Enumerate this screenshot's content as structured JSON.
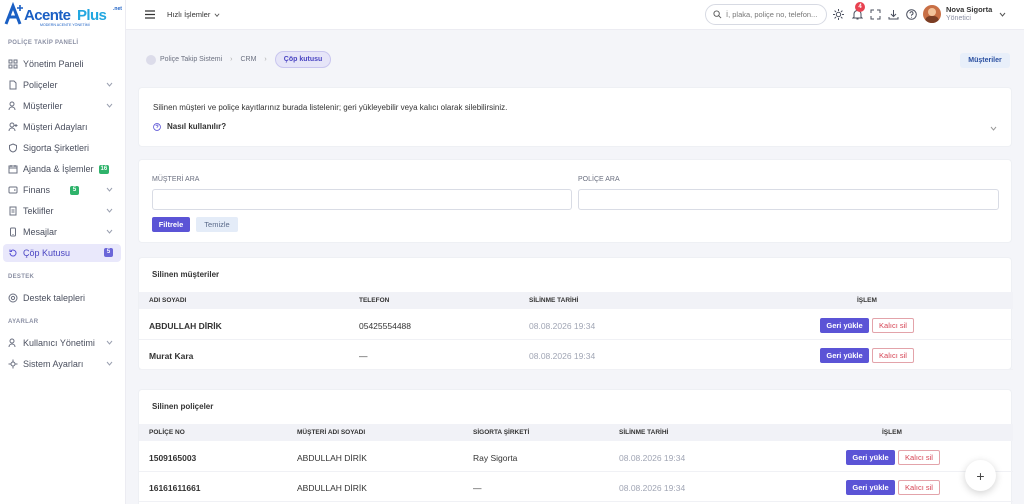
{
  "logo": {
    "name": "AcentePlus",
    "net": ".net",
    "tagline": "MODERN ACENTE YÖNETİMİ"
  },
  "sidebar": {
    "section1": "POLİÇE TAKİP PANELİ",
    "items": [
      {
        "label": "Yönetim Paneli",
        "icon": "grid-icon"
      },
      {
        "label": "Poliçeler",
        "icon": "document-icon",
        "chevron": true
      },
      {
        "label": "Müşteriler",
        "icon": "users-icon",
        "chevron": true
      },
      {
        "label": "Müşteri Adayları",
        "icon": "user-plus-icon"
      },
      {
        "label": "Sigorta Şirketleri",
        "icon": "shield-icon"
      },
      {
        "label": "Ajanda & İşlemler",
        "icon": "calendar-icon",
        "badge": "16",
        "badge_color": "#2fb36b"
      },
      {
        "label": "Finans",
        "icon": "wallet-icon",
        "badge": "5",
        "badge_color": "#2fb36b",
        "chevron": true
      },
      {
        "label": "Teklifler",
        "icon": "file-icon",
        "chevron": true
      },
      {
        "label": "Mesajlar",
        "icon": "phone-icon",
        "chevron": true
      },
      {
        "label": "Çöp Kutusu",
        "icon": "recycle-icon",
        "badge": "5",
        "badge_color": "#6b66d9",
        "active": true
      }
    ],
    "section2": "DESTEK",
    "support": {
      "label": "Destek talepleri",
      "icon": "support-icon"
    },
    "section3": "AYARLAR",
    "settings": [
      {
        "label": "Kullanıcı Yönetimi",
        "icon": "user-settings-icon",
        "chevron": true
      },
      {
        "label": "Sistem Ayarları",
        "icon": "gear-icon",
        "chevron": true
      }
    ]
  },
  "topbar": {
    "quick_actions": "Hızlı İşlemler",
    "search_placeholder": "İ, plaka, poliçe no, telefon...",
    "notif_count": "4",
    "user_name": "Nova Sigorta",
    "user_role": "Yönetici"
  },
  "breadcrumb": {
    "items": [
      "Poliçe Takip Sistemi",
      "CRM",
      "Çöp kutusu"
    ],
    "right_button": "Müşteriler"
  },
  "info": {
    "text": "Silinen müşteri ve poliçe kayıtlarınız burada listelenir; geri yükleyebilir veya kalıcı olarak silebilirsiniz.",
    "howto": "Nasıl kullanılır?"
  },
  "filter": {
    "customer_label": "MÜŞTERİ ARA",
    "policy_label": "POLİÇE ARA",
    "customer_value": "",
    "policy_value": "",
    "filter_btn": "Filtrele",
    "clear_btn": "Temizle"
  },
  "deleted_customers": {
    "title": "Silinen müşteriler",
    "headers": [
      "ADI SOYADI",
      "TELEFON",
      "SİLİNME TARİHİ",
      "İŞLEM"
    ],
    "rows": [
      {
        "name": "ABDULLAH DİRİK",
        "phone": "05425554488",
        "date": "08.08.2026 19:34"
      },
      {
        "name": "Murat Kara",
        "phone": "—",
        "date": "08.08.2026 19:34"
      }
    ],
    "restore": "Geri yükle",
    "delete": "Kalıcı sil"
  },
  "deleted_policies": {
    "title": "Silinen poliçeler",
    "headers": [
      "POLİÇE NO",
      "MÜŞTERİ ADI SOYADI",
      "SİGORTA ŞİRKETİ",
      "SİLİNME TARİHİ",
      "İŞLEM"
    ],
    "rows": [
      {
        "no": "1509165003",
        "customer": "ABDULLAH DİRİK",
        "company": "Ray Sigorta",
        "date": "08.08.2026 19:34"
      },
      {
        "no": "16161611661",
        "customer": "ABDULLAH DİRİK",
        "company": "—",
        "date": "08.08.2026 19:34"
      }
    ],
    "restore": "Geri yükle",
    "delete": "Kalıcı sil"
  },
  "fab": "+"
}
